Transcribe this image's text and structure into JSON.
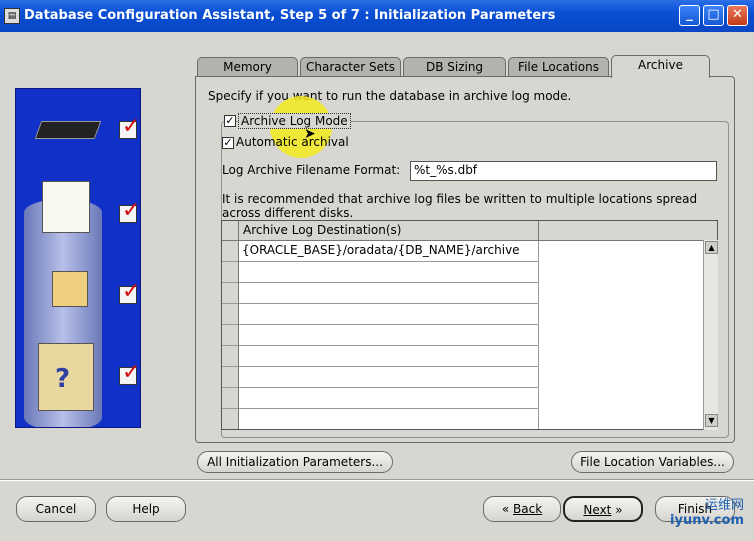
{
  "window": {
    "title": "Database Configuration Assistant, Step 5 of 7 : Initialization Parameters",
    "app_icon": "dbca-icon",
    "min": "_",
    "max": "□",
    "close": "✕"
  },
  "tabs": [
    "Memory",
    "Character Sets",
    "DB Sizing",
    "File Locations",
    "Archive"
  ],
  "active_tab": "Archive",
  "archive": {
    "instruction": "Specify if you want to run the database in archive log mode.",
    "archive_log_mode_label": "Archive Log Mode",
    "archive_log_mode_checked": true,
    "automatic_archival_label": "Automatic archival",
    "automatic_archival_checked": true,
    "filename_format_label": "Log Archive Filename Format:",
    "filename_format_value": "%t_%s.dbf",
    "recommendation_line1": "It is recommended that archive log files be written to multiple locations spread",
    "recommendation_line2": "across different disks.",
    "table_header": "Archive Log Destination(s)",
    "destinations": [
      "{ORACLE_BASE}/oradata/{DB_NAME}/archive",
      "",
      "",
      "",
      "",
      "",
      "",
      "",
      "",
      ""
    ]
  },
  "buttons": {
    "all_params": "All Initialization Parameters...",
    "file_location_vars": "File Location Variables...",
    "cancel": "Cancel",
    "help": "Help",
    "back": "Back",
    "next": "Next",
    "finish": "Finish"
  },
  "watermark": {
    "line1": "运维网",
    "line2": "iyunv.com"
  },
  "colors": {
    "titlebar": "#0a4fd4",
    "side_panel": "#1030c8",
    "highlight": "#f5eb1e",
    "check_red": "#d01010"
  }
}
